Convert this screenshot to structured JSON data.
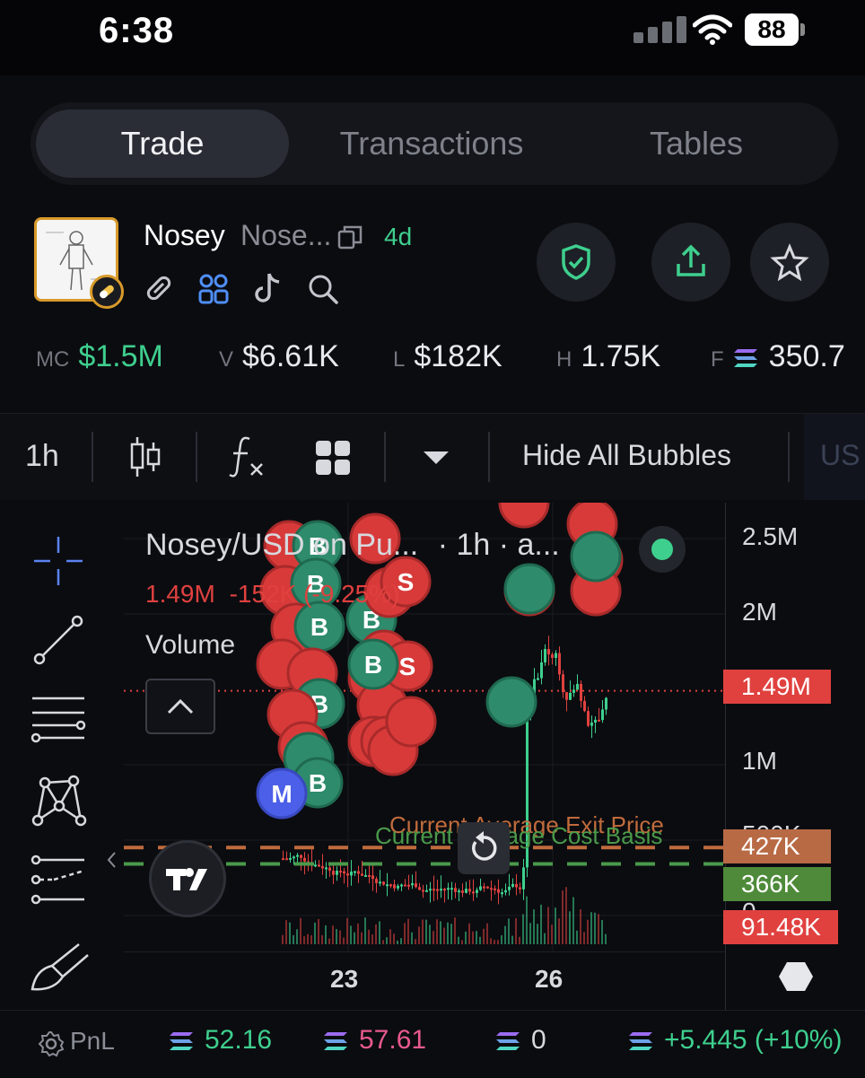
{
  "status": {
    "time": "6:38",
    "battery": "88"
  },
  "tabs": [
    {
      "label": "Trade",
      "active": true
    },
    {
      "label": "Transactions",
      "active": false
    },
    {
      "label": "Tables",
      "active": false
    }
  ],
  "token": {
    "name": "Nosey",
    "symbol": "Nose...",
    "age": "4d"
  },
  "stats": {
    "mc_label": "MC",
    "mc": "$1.5M",
    "v_label": "V",
    "v": "$6.61K",
    "l_label": "L",
    "l": "$182K",
    "h_label": "H",
    "h": "1.75K",
    "f_label": "F",
    "f": "350.7"
  },
  "toolbar": {
    "interval": "1h",
    "hide_bubbles": "Hide All Bubbles",
    "currency": "US"
  },
  "chart": {
    "pair": "Nosey/USD on Pu...",
    "interval": "· 1h · a...",
    "last_price": "1.49M",
    "change": "-152K (-9.25%)",
    "volume_label": "Volume",
    "exit_label": "Current Average Exit Price",
    "cost_label": "Current Average Cost Basis",
    "y_ticks": [
      "2.5M",
      "2M",
      "1M",
      "500K",
      "0"
    ],
    "price_tag": "1.49M",
    "exit_tag": "427K",
    "cost_tag": "366K",
    "volume_tag": "91.48K",
    "x_ticks": [
      "23",
      "26"
    ]
  },
  "chart_data": {
    "type": "candlestick",
    "price_scale": {
      "min": 0,
      "max": 2500000
    },
    "last_price": 1490000,
    "average_exit_price": 427000,
    "average_cost_basis": 366000,
    "last_volume": 91480
  },
  "pnl": {
    "label": "PnL",
    "bought": "52.16",
    "sold": "57.61",
    "holding": "0",
    "pnl": "+5.445 (+10%)"
  },
  "colors": {
    "green": "#3ecf8e",
    "red": "#e0413f",
    "bg": "#0b0c10"
  }
}
